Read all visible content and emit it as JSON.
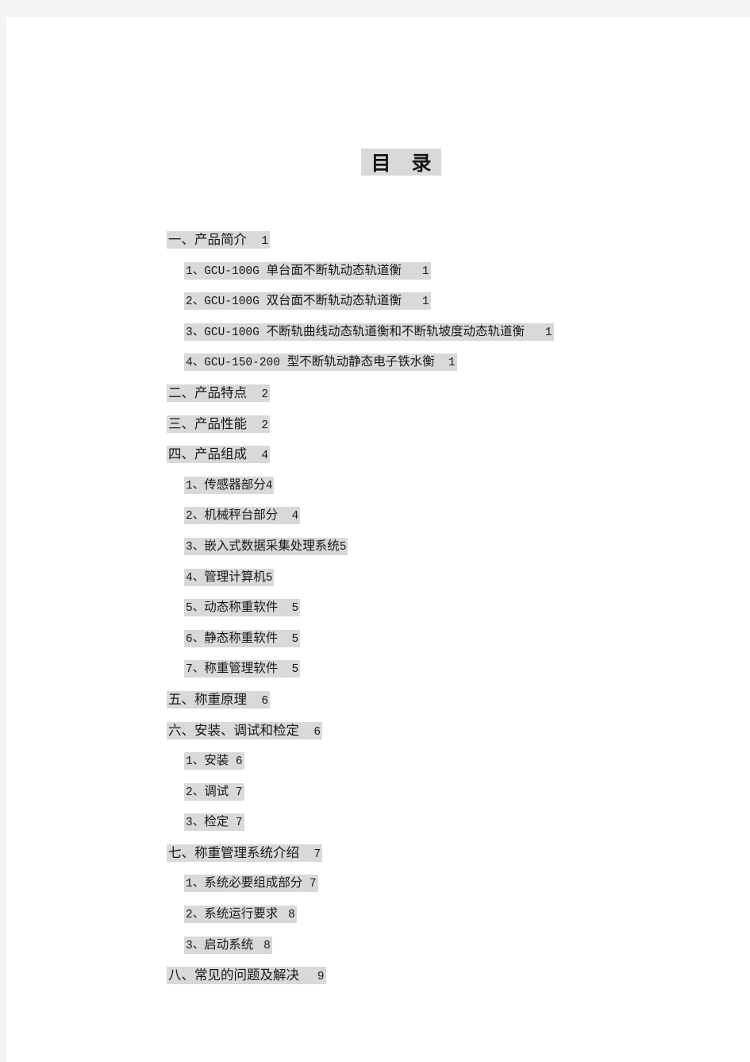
{
  "document": {
    "title_part_1": "目",
    "title_part_2": "录",
    "page_background": "#ffffff",
    "canvas_background": "#f4f4f5",
    "highlight_color": "#d9d9d9",
    "text_color": "#16191c"
  },
  "toc": {
    "entries": [
      {
        "level": 1,
        "number": "一、",
        "text": "产品简介",
        "gap": "    ",
        "page": "1"
      },
      {
        "level": 2,
        "number": "1、",
        "latin": "GCU-100G ",
        "text": "单台面不断轨动态轨道衡",
        "gap": "      ",
        "page": "1"
      },
      {
        "level": 2,
        "number": "2、",
        "latin": "GCU-100G ",
        "text": "双台面不断轨动态轨道衡",
        "gap": "      ",
        "page": "1"
      },
      {
        "level": 2,
        "number": "3、",
        "latin": "GCU-100G ",
        "text": "不断轨曲线动态轨道衡和不断轨坡度动态轨道衡",
        "gap": "      ",
        "page": "1"
      },
      {
        "level": 2,
        "number": "4、",
        "latin": "GCU-150-200 ",
        "text": "型不断轨动静态电子铁水衡",
        "gap": "    ",
        "page": "1"
      },
      {
        "level": 1,
        "number": "二、",
        "text": "产品特点",
        "gap": "    ",
        "page": "2"
      },
      {
        "level": 1,
        "number": "三、",
        "text": "产品性能",
        "gap": "    ",
        "page": "2"
      },
      {
        "level": 1,
        "number": "四、",
        "text": "产品组成",
        "gap": "    ",
        "page": "4"
      },
      {
        "level": 2,
        "number": "1、",
        "latin": "",
        "text": "传感器部分",
        "gap": "",
        "page": "4"
      },
      {
        "level": 2,
        "number": "2、",
        "latin": "",
        "text": "机械秤台部分",
        "gap": "    ",
        "page": "4"
      },
      {
        "level": 2,
        "number": "3、",
        "latin": "",
        "text": "嵌入式数据采集处理系统",
        "gap": "",
        "page": "5"
      },
      {
        "level": 2,
        "number": "4、",
        "latin": "",
        "text": "管理计算机",
        "gap": "",
        "page": "5"
      },
      {
        "level": 2,
        "number": "5、",
        "latin": "",
        "text": "动态称重软件",
        "gap": "    ",
        "page": "5"
      },
      {
        "level": 2,
        "number": "6、",
        "latin": "",
        "text": "静态称重软件",
        "gap": "    ",
        "page": "5"
      },
      {
        "level": 2,
        "number": "7、",
        "latin": "",
        "text": "称重管理软件",
        "gap": "    ",
        "page": "5"
      },
      {
        "level": 1,
        "number": "五、",
        "text": "称重原理",
        "gap": "    ",
        "page": "6"
      },
      {
        "level": 1,
        "number": "六、",
        "text": "安装、调试和检定",
        "gap": "    ",
        "page": "6"
      },
      {
        "level": 2,
        "number": "1、",
        "latin": "",
        "text": "安装",
        "gap": "  ",
        "page": "6"
      },
      {
        "level": 2,
        "number": "2、",
        "latin": "",
        "text": "调试",
        "gap": "  ",
        "page": "7"
      },
      {
        "level": 2,
        "number": "3、",
        "latin": "",
        "text": "检定",
        "gap": "  ",
        "page": "7"
      },
      {
        "level": 1,
        "number": "七、",
        "text": "称重管理系统介绍",
        "gap": "    ",
        "page": "7"
      },
      {
        "level": 2,
        "number": "1、",
        "latin": "",
        "text": "系统必要组成部分",
        "gap": "  ",
        "page": "7"
      },
      {
        "level": 2,
        "number": "2、",
        "latin": "",
        "text": "系统运行要求",
        "gap": "   ",
        "page": "8"
      },
      {
        "level": 2,
        "number": "3、",
        "latin": "",
        "text": "启动系统",
        "gap": "   ",
        "page": "8"
      },
      {
        "level": 1,
        "number": "八、",
        "text": "常见的问题及解决",
        "gap": "     ",
        "page": "9"
      }
    ]
  }
}
